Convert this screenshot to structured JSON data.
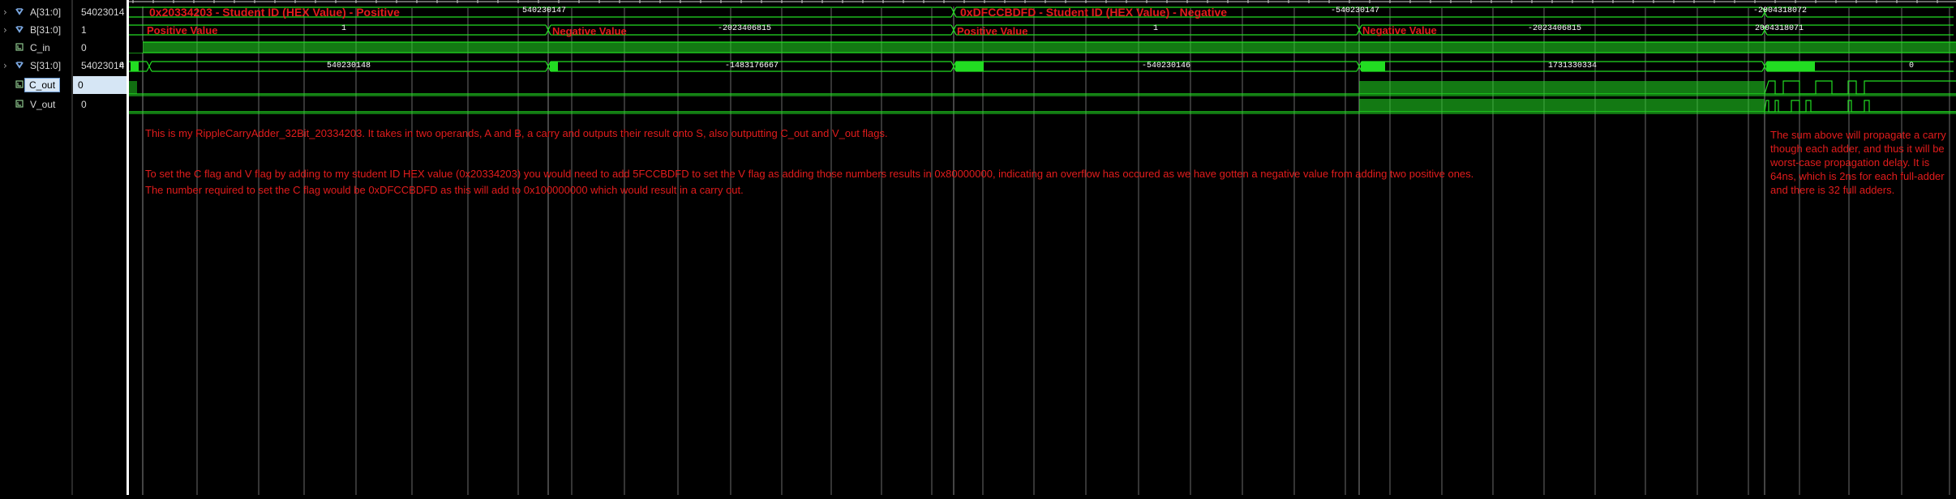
{
  "signals": [
    {
      "name": "A[31:0]",
      "icon": "bus-icon",
      "expandable": true,
      "value": "540230147"
    },
    {
      "name": "B[31:0]",
      "icon": "bus-icon",
      "expandable": true,
      "value": "1"
    },
    {
      "name": "C_in",
      "icon": "bit-icon",
      "expandable": false,
      "value": "0"
    },
    {
      "name": "S[31:0]",
      "icon": "bus-icon",
      "expandable": true,
      "value": "540230148"
    },
    {
      "name": "C_out",
      "icon": "bit-icon",
      "expandable": false,
      "value": "0",
      "selected": true
    },
    {
      "name": "V_out",
      "icon": "bit-icon",
      "expandable": false,
      "value": "0"
    }
  ],
  "value_column": [
    "54023014",
    "1",
    "0",
    "54023014",
    "0",
    "0"
  ],
  "waveform": {
    "a_values": [
      "540230147",
      "-540230147",
      "-2004318072"
    ],
    "a_labels": [
      "0x20334203 - Student ID (HEX Value) - Positive",
      "0xDFCCBDFD - Student ID (HEX Value) - Negative"
    ],
    "b_values": [
      "1",
      "-2023406815",
      "1",
      "-2023406815",
      "2004318071"
    ],
    "b_labels": [
      "Positive Value",
      "Negative Value",
      "Positive Value",
      "Negative Value"
    ],
    "s_values": [
      "0",
      "540230148",
      "-1483176667",
      "-540230146",
      "1731330334",
      "0"
    ]
  },
  "annotations": {
    "intro": "This is my RippleCarryAdder_32Bit_20334203. It takes in two operands, A and B, a carry and outputs their result onto S, also outputting C_out and V_out flags.",
    "flags_line1": "To set the C flag and V flag by adding to my student ID HEX value (0x20334203) you would need to add 5FCCBDFD to set the V flag as adding those numbers results in 0x80000000, indicating an overflow has occured as we have gotten a negative value from adding two positive ones.",
    "flags_line2": "The number required to set the C flag would be 0xDFCCBDFD as this will add to 0x100000000 which would result in a carry out.",
    "propagation": "The sum above will propagate a carry though each adder, and thus it will be worst-case propagation delay. It is 64ns, which is 2ns for each full-adder and there is 32 full adders."
  },
  "colors": {
    "wave": "#22dd22",
    "annotation": "#e21c1c",
    "background": "#000000"
  }
}
